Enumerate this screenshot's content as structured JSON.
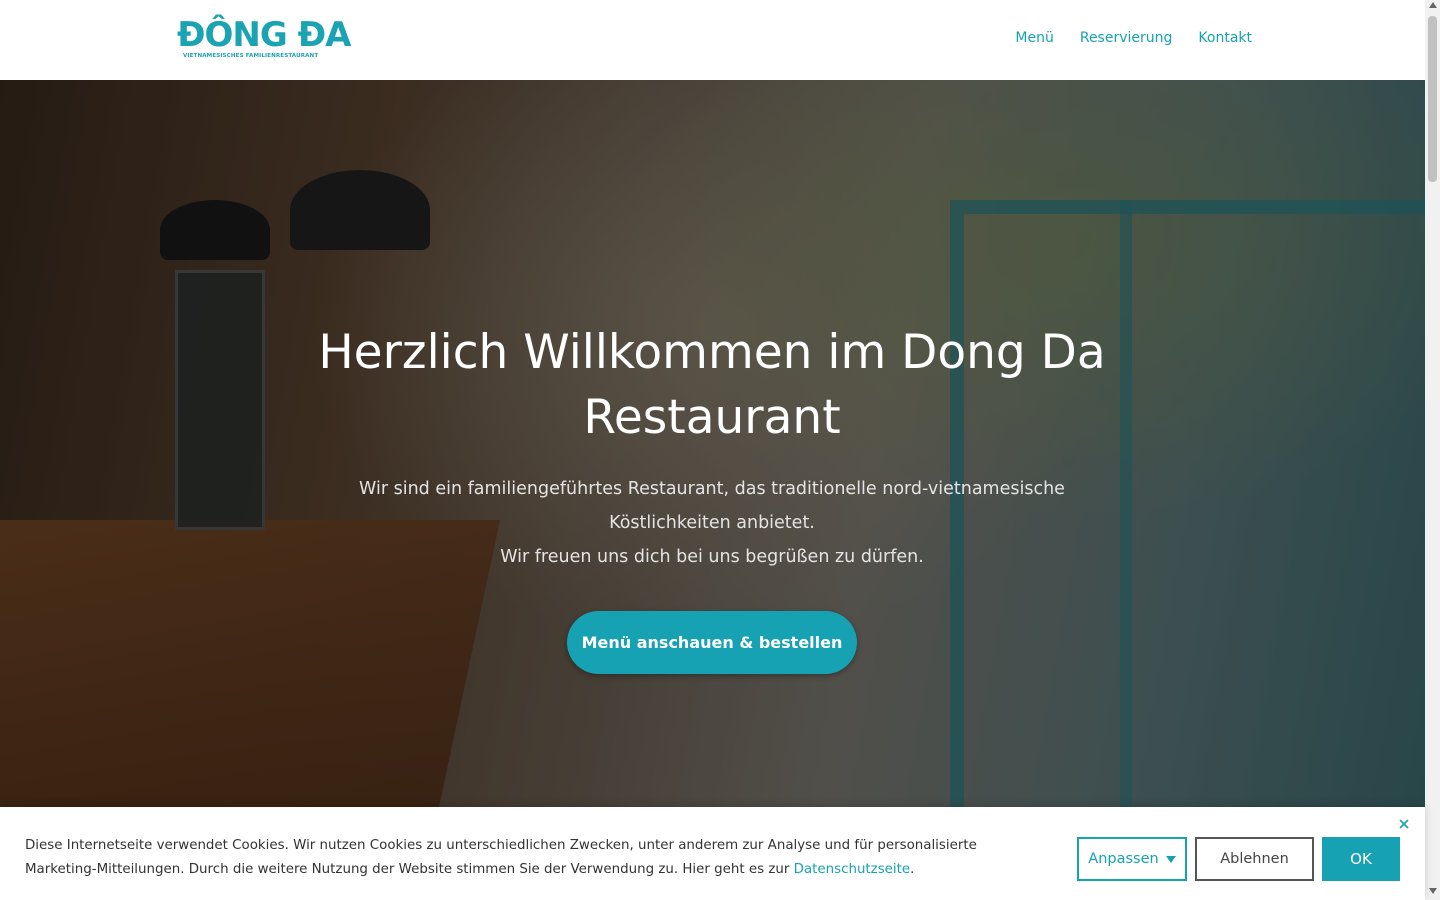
{
  "header": {
    "logo_main": "ĐÔNG ĐA",
    "logo_sub": "VIETNAMESISCHES FAMILIENRESTAURANT",
    "nav": [
      "Menü",
      "Reservierung",
      "Kontakt"
    ]
  },
  "hero": {
    "title": "Herzlich Willkommen im Dong Da Restaurant",
    "text_line1": "Wir sind ein familiengeführtes Restaurant, das traditionelle nord-vietnamesische Köstlichkeiten anbietet.",
    "text_line2": "Wir freuen uns dich bei uns begrüßen zu dürfen.",
    "cta_label": "Menü anschauen & bestellen"
  },
  "cookie": {
    "text": "Diese Internetseite verwendet Cookies. Wir nutzen Cookies zu unterschiedlichen Zwecken, unter anderem zur Analyse und für personalisierte Marketing-Mitteilungen. Durch die weitere Nutzung der Website stimmen Sie der Verwendung zu. Hier geht es zur ",
    "link_label": "Datenschutzseite",
    "text_end": ".",
    "customize_label": "Anpassen",
    "decline_label": "Ablehnen",
    "ok_label": "OK"
  },
  "colors": {
    "accent": "#17a2b3"
  }
}
